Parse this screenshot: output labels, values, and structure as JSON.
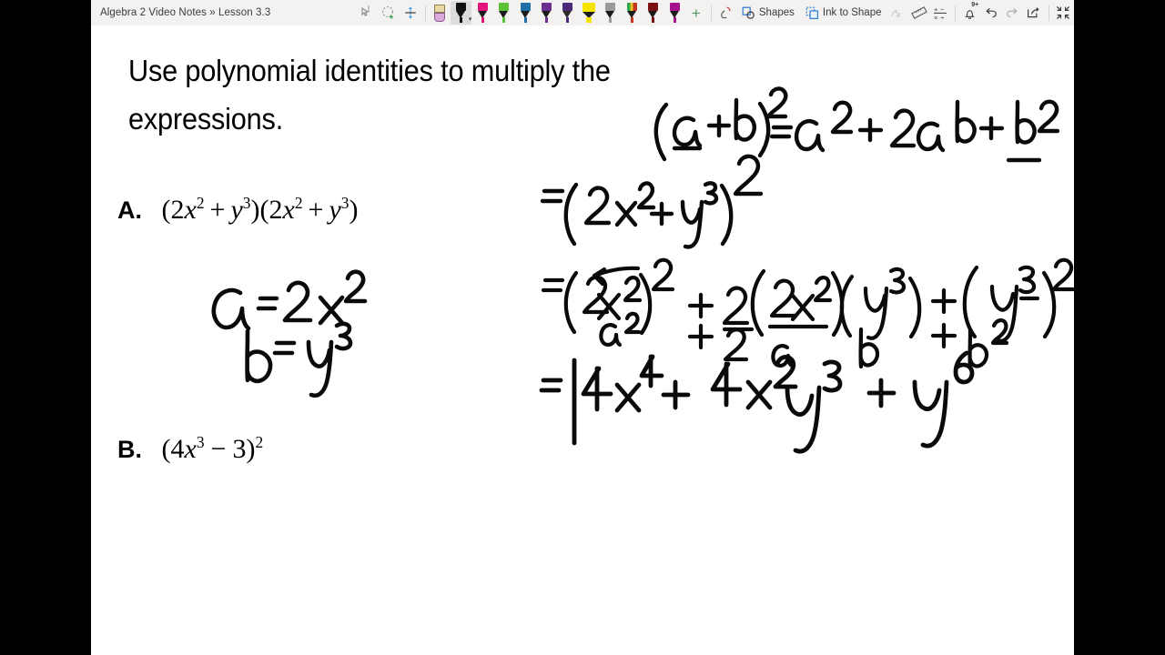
{
  "window": {
    "background_letterbox_color": "#000000",
    "app_background": "#ffffff"
  },
  "toolbar": {
    "breadcrumb": "Algebra 2 Video Notes » Lesson 3.3",
    "background_color": "#f3f2f1",
    "selected_tool": "black-pen",
    "tools": [
      {
        "name": "lasso-select-icon",
        "label": "Lasso Select",
        "kind": "icon",
        "enabled": true
      },
      {
        "name": "ink-eraser-area-icon",
        "label": "Select Ink Area",
        "kind": "icon",
        "enabled": true
      },
      {
        "name": "insert-space-icon",
        "label": "Insert or Remove Space",
        "kind": "icon",
        "enabled": true
      }
    ],
    "pens": [
      {
        "name": "eraser",
        "label": "Eraser",
        "color": "#dbaada",
        "selected": false
      },
      {
        "name": "black-pen",
        "label": "Pen - Black",
        "color": "#111111",
        "selected": true
      },
      {
        "name": "pink-pen",
        "label": "Pen - Pink",
        "color": "#e3147c",
        "selected": false
      },
      {
        "name": "green-pen",
        "label": "Pen - Green",
        "color": "#5bc236",
        "selected": false
      },
      {
        "name": "blue-pen",
        "label": "Pen - Blue",
        "color": "#1d6fa5",
        "selected": false
      },
      {
        "name": "purple-pen",
        "label": "Pen - Purple",
        "color": "#6b2f91",
        "selected": false
      },
      {
        "name": "violet-pen",
        "label": "Pen - Violet",
        "color": "#4b2a7a",
        "selected": false
      },
      {
        "name": "yellow-highlighter",
        "label": "Highlighter - Yellow",
        "color": "#f5e400",
        "selected": false
      },
      {
        "name": "silver-pen",
        "label": "Pen - Silver",
        "color": "#9a9a9a",
        "selected": false
      },
      {
        "name": "rainbow-pen",
        "label": "Pen - Rainbow",
        "color": "#2aa84a",
        "selected": false
      },
      {
        "name": "dark-red-pen",
        "label": "Pen - Dark Red",
        "color": "#7a1111",
        "selected": false
      },
      {
        "name": "magenta-pen",
        "label": "Pen - Magenta",
        "color": "#a8118c",
        "selected": false
      }
    ],
    "add_pen_label": "+",
    "shapes_label": "Shapes",
    "ink_to_shape_label": "Ink to Shape",
    "right_tools": [
      {
        "name": "ink-to-text-icon",
        "label": "Ink to Text",
        "enabled": false
      },
      {
        "name": "ruler-icon",
        "label": "Ruler",
        "enabled": true
      },
      {
        "name": "ink-to-math-icon",
        "label": "Ink to Math",
        "enabled": true
      },
      {
        "name": "notifications-bell-icon",
        "label": "Notifications",
        "badge": "9+",
        "enabled": true
      },
      {
        "name": "undo-icon",
        "label": "Undo",
        "enabled": true
      },
      {
        "name": "redo-icon",
        "label": "Redo",
        "enabled": false
      },
      {
        "name": "share-icon",
        "label": "Share",
        "enabled": true
      },
      {
        "name": "collapse-ribbon-icon",
        "label": "Collapse",
        "enabled": true
      }
    ]
  },
  "page": {
    "prompt": "Use polynomial identities to multiply the expressions.",
    "problem_a": {
      "label": "A.",
      "expression_plain": "(2x^2 + y^3)(2x^2 + y^3)",
      "parts": {
        "open1": "(",
        "coef1": "2",
        "var1": "x",
        "exp1": "2",
        "plus1": "+",
        "var2": "y",
        "exp2": "3",
        "close1": ")",
        "open2": "(",
        "coef2": "2",
        "var3": "x",
        "exp3": "2",
        "plus2": "+",
        "var4": "y",
        "exp4": "3",
        "close2": ")"
      }
    },
    "problem_b": {
      "label": "B.",
      "expression_plain": "(4x^3 - 3)^2",
      "parts": {
        "open": "(",
        "coef": "4",
        "var": "x",
        "exp": "3",
        "minus": "−",
        "const": "3",
        "close": ")",
        "power": "2"
      }
    }
  },
  "handwriting": {
    "ink_color": "#0a0a0a",
    "notes": [
      {
        "name": "identity-formula",
        "text": "(a+b)² = a² + 2ab + b²",
        "annotation": "a and b are underlined"
      },
      {
        "name": "equals-squared-a",
        "text": "= (2x² + y³)²"
      },
      {
        "name": "substitution-a",
        "text": "a = 2x²"
      },
      {
        "name": "substitution-b",
        "text": "b = y³"
      },
      {
        "name": "expansion-line",
        "text": "= (2x²)² + 2(2x²)(y³) + (y³)²"
      },
      {
        "name": "expansion-annotations",
        "text": "a²  +2  a  b  + b²"
      },
      {
        "name": "final-answer",
        "text": "= 4x⁴ + 4x²y³ + y⁶"
      }
    ]
  }
}
